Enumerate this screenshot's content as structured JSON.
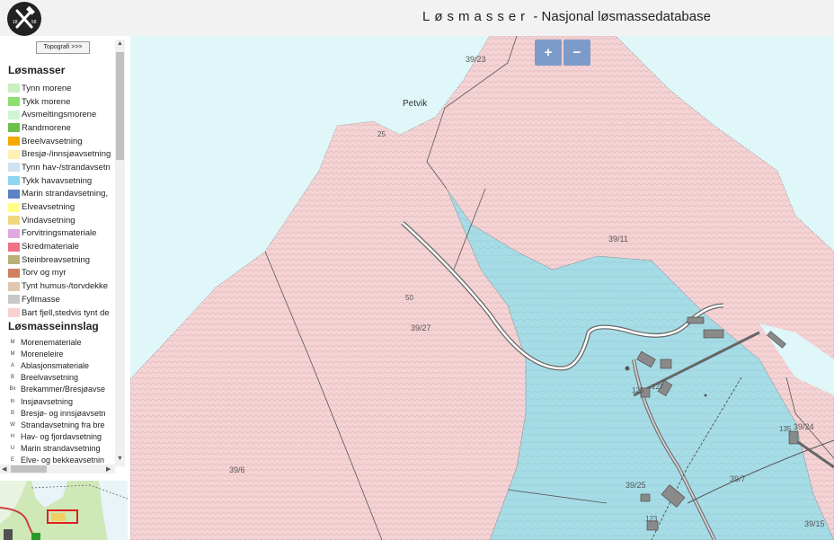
{
  "header": {
    "title_spaced": "Løsmasser",
    "title_separator": " - ",
    "title_rest": "Nasjonal løsmassedatabase",
    "logo_text_left": "18",
    "logo_text_right": "58",
    "logo_icon": "hammer-pick-icon"
  },
  "sidebar": {
    "topo_button": "Topografi >>>",
    "losmasser_title": "Løsmasser",
    "losmasser_items": [
      {
        "label": "Tynn morene",
        "color": "#c8f0c0"
      },
      {
        "label": "Tykk morene",
        "color": "#8ee06e"
      },
      {
        "label": "Avsmeltingsmorene",
        "color": "#cdf5d2"
      },
      {
        "label": "Randmorene",
        "color": "#6cc04c"
      },
      {
        "label": "Breelvavsetning",
        "color": "#f5a800"
      },
      {
        "label": "Bresjø-/innsjøavsetning",
        "color": "#fff0b4"
      },
      {
        "label": "Tynn hav-/strandavsetn",
        "color": "#cde4f0"
      },
      {
        "label": "Tykk havavsetning",
        "color": "#8dd6f0"
      },
      {
        "label": "Marin strandavsetning,",
        "color": "#5b82c4"
      },
      {
        "label": "Elveavsetning",
        "color": "#ffff88"
      },
      {
        "label": "Vindavsetning",
        "color": "#f0d77c"
      },
      {
        "label": "Forvitringsmateriale",
        "color": "#e0a8e0"
      },
      {
        "label": "Skredmateriale",
        "color": "#f07088"
      },
      {
        "label": "Steinbreavsetning",
        "color": "#b8b078"
      },
      {
        "label": "Torv og myr",
        "color": "#d08060"
      },
      {
        "label": "Tynt humus-/torvdekke",
        "color": "#e0c8b0"
      },
      {
        "label": "Fyllmasse",
        "color": "#c8c8c8"
      },
      {
        "label": "Bart fjell,stedvis tynt de",
        "color": "#f8d0d0"
      }
    ],
    "innslag_title": "Løsmasseinnslag",
    "innslag_items": [
      {
        "code": "M",
        "label": "Morenemateriale"
      },
      {
        "code": "M",
        "label": "Moreneleire"
      },
      {
        "code": "A",
        "label": "Ablasjonsmateriale"
      },
      {
        "code": "B",
        "label": "Breelvavsetning"
      },
      {
        "code": "Bx",
        "label": "Brekammer/Bresjøavse"
      },
      {
        "code": "In",
        "label": "Insjøavsetning"
      },
      {
        "code": "B",
        "label": "Bresjø- og innsjøavsetn"
      },
      {
        "code": "W",
        "label": "Strandavsetning fra bre"
      },
      {
        "code": "H",
        "label": "Hav- og fjordavsetning"
      },
      {
        "code": "U",
        "label": "Marin strandavsetning"
      },
      {
        "code": "E",
        "label": "Elve- og bekkeavsetnin"
      }
    ]
  },
  "map": {
    "zoom_in": "+",
    "zoom_out": "−",
    "place_name": "Petvik",
    "labels": [
      {
        "text": "39/23",
        "id": "39-23"
      },
      {
        "text": "25",
        "id": "25"
      },
      {
        "text": "39/11",
        "id": "39-11"
      },
      {
        "text": "50",
        "id": "50"
      },
      {
        "text": "39/27",
        "id": "39-27"
      },
      {
        "text": "125",
        "id": "125"
      },
      {
        "text": "127",
        "id": "127"
      },
      {
        "text": "135",
        "id": "135"
      },
      {
        "text": "39/24",
        "id": "39-24"
      },
      {
        "text": "39/6",
        "id": "39-6"
      },
      {
        "text": "39/25",
        "id": "39-25"
      },
      {
        "text": "39/7",
        "id": "39-7"
      },
      {
        "text": "123",
        "id": "123"
      },
      {
        "text": "39/15",
        "id": "39-15"
      }
    ],
    "colors": {
      "sea": "#dff7f8",
      "bedrock": "#f5d3d5",
      "marine": "#a6dce6",
      "contour": "#c9a5a8"
    }
  }
}
